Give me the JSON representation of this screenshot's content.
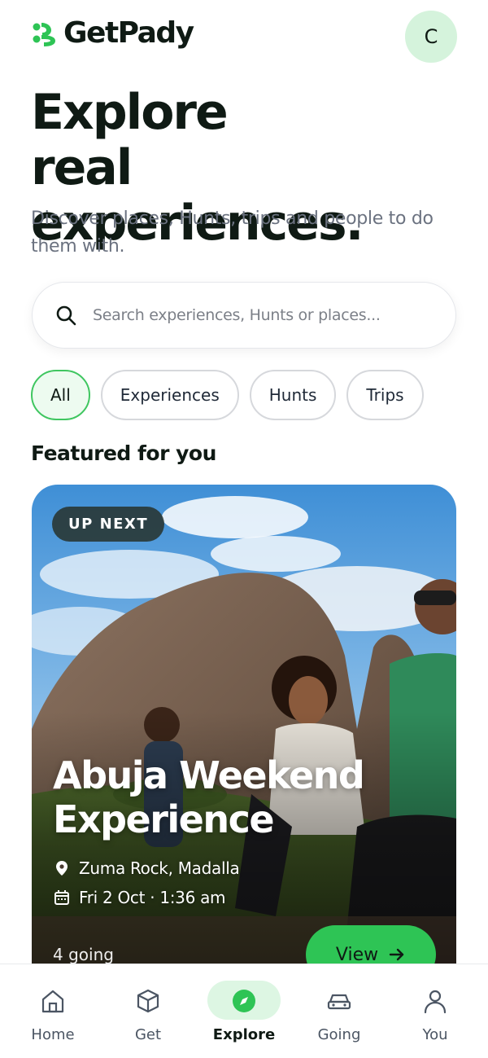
{
  "app": {
    "name": "GetPady",
    "avatar_initial": "C"
  },
  "hero": {
    "title_line1": "Explore",
    "title_line2": "real experiences.",
    "subtitle": "Discover places, Hunts, trips and people to do them with."
  },
  "search": {
    "placeholder": "Search experiences, Hunts or places..."
  },
  "filters": [
    {
      "label": "All",
      "active": true
    },
    {
      "label": "Experiences",
      "active": false
    },
    {
      "label": "Hunts",
      "active": false
    },
    {
      "label": "Trips",
      "active": false
    }
  ],
  "featured": {
    "section_title": "Featured for you",
    "card": {
      "badge": "UP NEXT",
      "title": "Abuja Weekend Experience",
      "location": "Zuma Rock, Madalla",
      "datetime": "Fri 2 Oct · 1:36 am",
      "going": "4 going",
      "cta": "View",
      "cta_icon": "arrow-right-icon"
    }
  },
  "tabbar": [
    {
      "label": "Home",
      "icon": "home-icon",
      "active": false
    },
    {
      "label": "Get",
      "icon": "cube-icon",
      "active": false
    },
    {
      "label": "Explore",
      "icon": "compass-icon",
      "active": true
    },
    {
      "label": "Going",
      "icon": "car-icon",
      "active": false
    },
    {
      "label": "You",
      "icon": "person-icon",
      "active": false
    }
  ],
  "colors": {
    "accent": "#2ec455",
    "accent_light": "#ddf6e3",
    "text": "#0f1a14",
    "muted": "#6b7280"
  }
}
